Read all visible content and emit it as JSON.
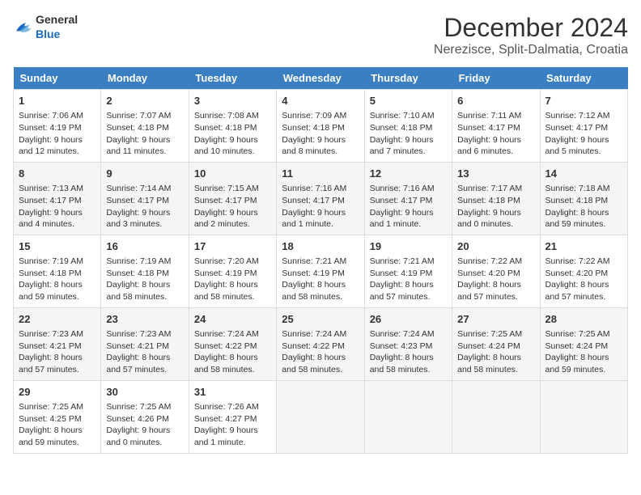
{
  "logo": {
    "general": "General",
    "blue": "Blue"
  },
  "title": "December 2024",
  "subtitle": "Nerezisce, Split-Dalmatia, Croatia",
  "days_header": [
    "Sunday",
    "Monday",
    "Tuesday",
    "Wednesday",
    "Thursday",
    "Friday",
    "Saturday"
  ],
  "weeks": [
    [
      {
        "day": "1",
        "sunrise": "Sunrise: 7:06 AM",
        "sunset": "Sunset: 4:19 PM",
        "daylight": "Daylight: 9 hours and 12 minutes."
      },
      {
        "day": "2",
        "sunrise": "Sunrise: 7:07 AM",
        "sunset": "Sunset: 4:18 PM",
        "daylight": "Daylight: 9 hours and 11 minutes."
      },
      {
        "day": "3",
        "sunrise": "Sunrise: 7:08 AM",
        "sunset": "Sunset: 4:18 PM",
        "daylight": "Daylight: 9 hours and 10 minutes."
      },
      {
        "day": "4",
        "sunrise": "Sunrise: 7:09 AM",
        "sunset": "Sunset: 4:18 PM",
        "daylight": "Daylight: 9 hours and 8 minutes."
      },
      {
        "day": "5",
        "sunrise": "Sunrise: 7:10 AM",
        "sunset": "Sunset: 4:18 PM",
        "daylight": "Daylight: 9 hours and 7 minutes."
      },
      {
        "day": "6",
        "sunrise": "Sunrise: 7:11 AM",
        "sunset": "Sunset: 4:17 PM",
        "daylight": "Daylight: 9 hours and 6 minutes."
      },
      {
        "day": "7",
        "sunrise": "Sunrise: 7:12 AM",
        "sunset": "Sunset: 4:17 PM",
        "daylight": "Daylight: 9 hours and 5 minutes."
      }
    ],
    [
      {
        "day": "8",
        "sunrise": "Sunrise: 7:13 AM",
        "sunset": "Sunset: 4:17 PM",
        "daylight": "Daylight: 9 hours and 4 minutes."
      },
      {
        "day": "9",
        "sunrise": "Sunrise: 7:14 AM",
        "sunset": "Sunset: 4:17 PM",
        "daylight": "Daylight: 9 hours and 3 minutes."
      },
      {
        "day": "10",
        "sunrise": "Sunrise: 7:15 AM",
        "sunset": "Sunset: 4:17 PM",
        "daylight": "Daylight: 9 hours and 2 minutes."
      },
      {
        "day": "11",
        "sunrise": "Sunrise: 7:16 AM",
        "sunset": "Sunset: 4:17 PM",
        "daylight": "Daylight: 9 hours and 1 minute."
      },
      {
        "day": "12",
        "sunrise": "Sunrise: 7:16 AM",
        "sunset": "Sunset: 4:17 PM",
        "daylight": "Daylight: 9 hours and 1 minute."
      },
      {
        "day": "13",
        "sunrise": "Sunrise: 7:17 AM",
        "sunset": "Sunset: 4:18 PM",
        "daylight": "Daylight: 9 hours and 0 minutes."
      },
      {
        "day": "14",
        "sunrise": "Sunrise: 7:18 AM",
        "sunset": "Sunset: 4:18 PM",
        "daylight": "Daylight: 8 hours and 59 minutes."
      }
    ],
    [
      {
        "day": "15",
        "sunrise": "Sunrise: 7:19 AM",
        "sunset": "Sunset: 4:18 PM",
        "daylight": "Daylight: 8 hours and 59 minutes."
      },
      {
        "day": "16",
        "sunrise": "Sunrise: 7:19 AM",
        "sunset": "Sunset: 4:18 PM",
        "daylight": "Daylight: 8 hours and 58 minutes."
      },
      {
        "day": "17",
        "sunrise": "Sunrise: 7:20 AM",
        "sunset": "Sunset: 4:19 PM",
        "daylight": "Daylight: 8 hours and 58 minutes."
      },
      {
        "day": "18",
        "sunrise": "Sunrise: 7:21 AM",
        "sunset": "Sunset: 4:19 PM",
        "daylight": "Daylight: 8 hours and 58 minutes."
      },
      {
        "day": "19",
        "sunrise": "Sunrise: 7:21 AM",
        "sunset": "Sunset: 4:19 PM",
        "daylight": "Daylight: 8 hours and 57 minutes."
      },
      {
        "day": "20",
        "sunrise": "Sunrise: 7:22 AM",
        "sunset": "Sunset: 4:20 PM",
        "daylight": "Daylight: 8 hours and 57 minutes."
      },
      {
        "day": "21",
        "sunrise": "Sunrise: 7:22 AM",
        "sunset": "Sunset: 4:20 PM",
        "daylight": "Daylight: 8 hours and 57 minutes."
      }
    ],
    [
      {
        "day": "22",
        "sunrise": "Sunrise: 7:23 AM",
        "sunset": "Sunset: 4:21 PM",
        "daylight": "Daylight: 8 hours and 57 minutes."
      },
      {
        "day": "23",
        "sunrise": "Sunrise: 7:23 AM",
        "sunset": "Sunset: 4:21 PM",
        "daylight": "Daylight: 8 hours and 57 minutes."
      },
      {
        "day": "24",
        "sunrise": "Sunrise: 7:24 AM",
        "sunset": "Sunset: 4:22 PM",
        "daylight": "Daylight: 8 hours and 58 minutes."
      },
      {
        "day": "25",
        "sunrise": "Sunrise: 7:24 AM",
        "sunset": "Sunset: 4:22 PM",
        "daylight": "Daylight: 8 hours and 58 minutes."
      },
      {
        "day": "26",
        "sunrise": "Sunrise: 7:24 AM",
        "sunset": "Sunset: 4:23 PM",
        "daylight": "Daylight: 8 hours and 58 minutes."
      },
      {
        "day": "27",
        "sunrise": "Sunrise: 7:25 AM",
        "sunset": "Sunset: 4:24 PM",
        "daylight": "Daylight: 8 hours and 58 minutes."
      },
      {
        "day": "28",
        "sunrise": "Sunrise: 7:25 AM",
        "sunset": "Sunset: 4:24 PM",
        "daylight": "Daylight: 8 hours and 59 minutes."
      }
    ],
    [
      {
        "day": "29",
        "sunrise": "Sunrise: 7:25 AM",
        "sunset": "Sunset: 4:25 PM",
        "daylight": "Daylight: 8 hours and 59 minutes."
      },
      {
        "day": "30",
        "sunrise": "Sunrise: 7:25 AM",
        "sunset": "Sunset: 4:26 PM",
        "daylight": "Daylight: 9 hours and 0 minutes."
      },
      {
        "day": "31",
        "sunrise": "Sunrise: 7:26 AM",
        "sunset": "Sunset: 4:27 PM",
        "daylight": "Daylight: 9 hours and 1 minute."
      },
      null,
      null,
      null,
      null
    ]
  ]
}
